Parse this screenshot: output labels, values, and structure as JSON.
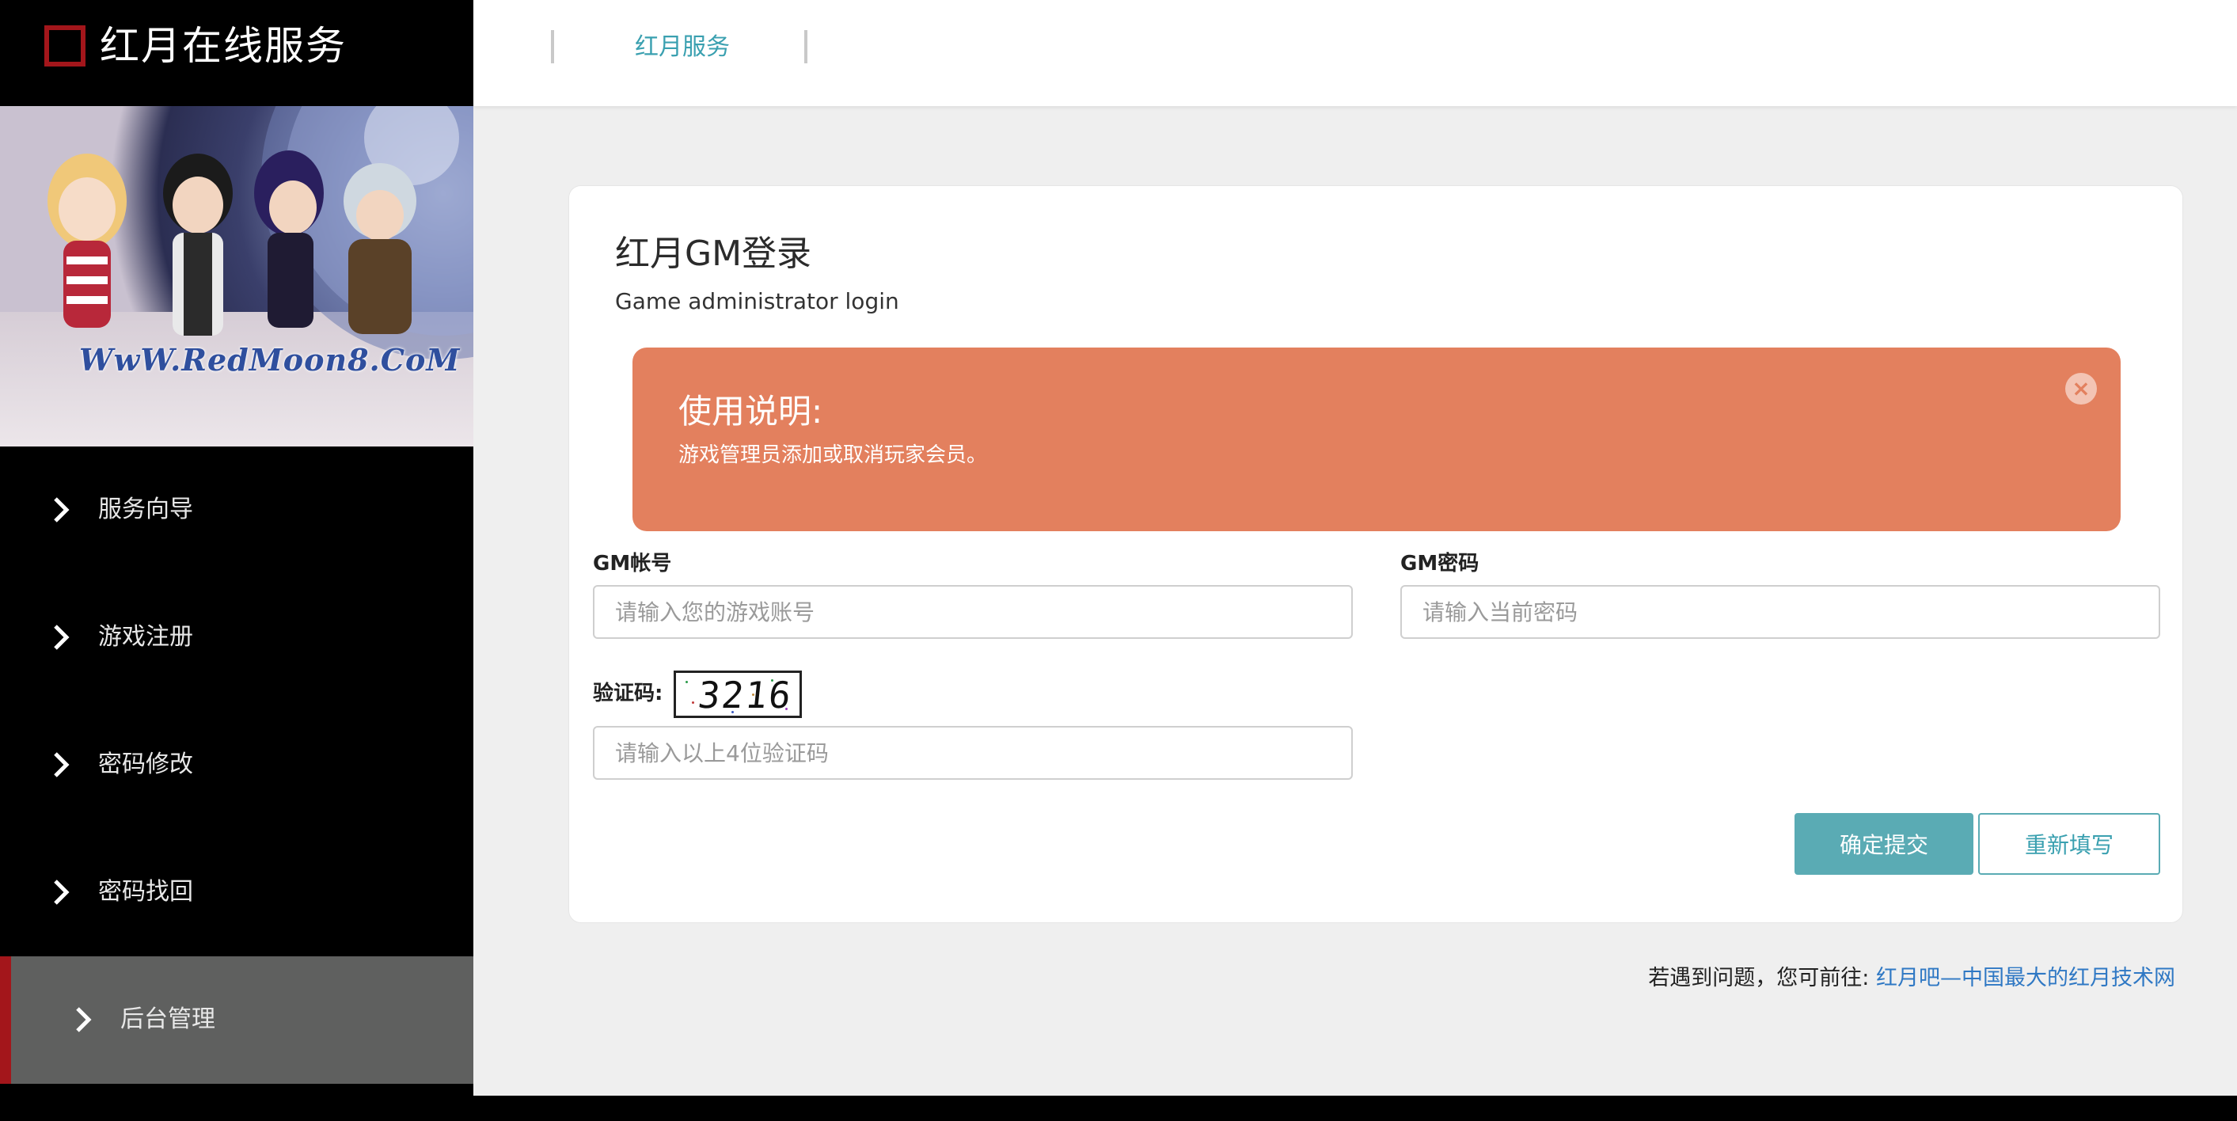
{
  "brand": {
    "title": "红月在线服务"
  },
  "banner": {
    "text": "WwW.RedMoon8.CoM"
  },
  "sidebar": {
    "items": [
      {
        "label": "服务向导",
        "active": false
      },
      {
        "label": "游戏注册",
        "active": false
      },
      {
        "label": "密码修改",
        "active": false
      },
      {
        "label": "密码找回",
        "active": false
      },
      {
        "label": "后台管理",
        "active": true
      }
    ]
  },
  "topbar": {
    "tab": "红月服务"
  },
  "card": {
    "title": "红月GM登录",
    "subtitle": "Game administrator login"
  },
  "alert": {
    "title": "使用说明:",
    "text": "游戏管理员添加或取消玩家会员。",
    "close": "×"
  },
  "form": {
    "account_label": "GM帐号",
    "account_placeholder": "请输入您的游戏账号",
    "password_label": "GM密码",
    "password_placeholder": "请输入当前密码",
    "captcha_label": "验证码:",
    "captcha_value": "3216",
    "captcha_placeholder": "请输入以上4位验证码",
    "submit_label": "确定提交",
    "reset_label": "重新填写"
  },
  "footer": {
    "prefix": "若遇到问题，您可前往:",
    "link": "红月吧—中国最大的红月技术网"
  },
  "colors": {
    "accent": "#3aa0b0",
    "brand_red": "#a3161b",
    "alert": "#e3805e",
    "button": "#5aabb4"
  }
}
